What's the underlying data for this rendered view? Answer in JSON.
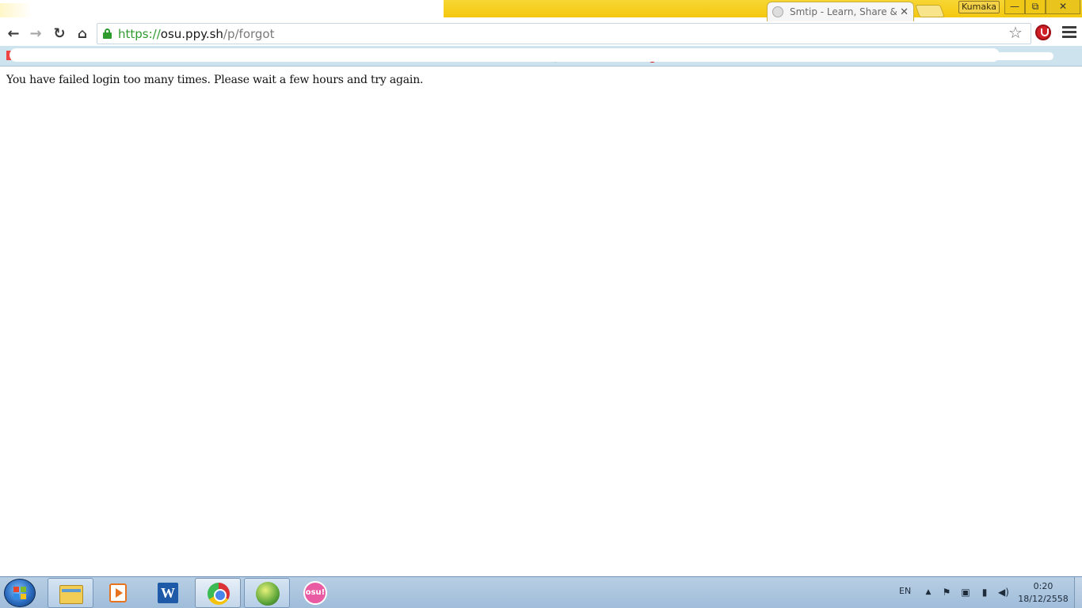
{
  "browser": {
    "tab": {
      "title": "Smtip - Learn, Share & Fu",
      "close_glyph": "✕"
    },
    "profile_name": "Kumaka",
    "window_controls": {
      "minimize": "—",
      "maximize": "⧉",
      "close": "✕"
    },
    "nav": {
      "back_glyph": "←",
      "forward_glyph": "→",
      "reload_glyph": "↻",
      "home_glyph": "⌂"
    },
    "address": {
      "scheme": "https://",
      "host": "osu.ppy.sh",
      "path": "/p/forgot"
    },
    "star_glyph": "☆"
  },
  "page": {
    "message": "You have failed login too many times. Please wait a few hours and try again."
  },
  "taskbar": {
    "apps": [
      {
        "name": "file-explorer"
      },
      {
        "name": "media-player"
      },
      {
        "name": "word",
        "glyph": "W"
      },
      {
        "name": "chrome"
      },
      {
        "name": "game"
      },
      {
        "name": "osu",
        "label": "osu!"
      }
    ],
    "tray": {
      "language": "EN",
      "up_glyph": "▲",
      "flag_glyph": "⚑",
      "power_glyph": "▣",
      "network_glyph": "▮",
      "volume_glyph": "◀)"
    },
    "clock": {
      "time": "0:20",
      "date": "18/12/2558"
    }
  },
  "colors": {
    "secure_green": "#2e9b2e",
    "titlebar_yellow": "#f4c80f",
    "taskbar_blue": "#a9c2dc"
  }
}
